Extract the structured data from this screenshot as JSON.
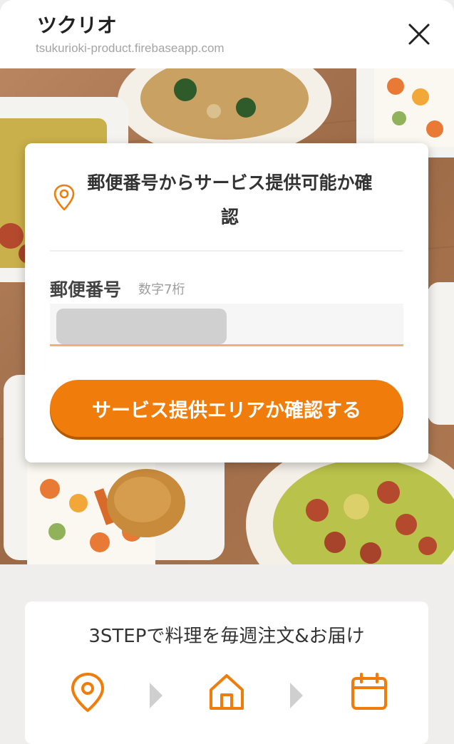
{
  "header": {
    "title": "ツクリオ",
    "url": "tsukurioki-product.firebaseapp.com"
  },
  "availability_card": {
    "title": "郵便番号からサービス提供可能か確認",
    "field_label": "郵便番号",
    "field_hint": "数字7桁",
    "input_value": "",
    "button_label": "サービス提供エリアか確認する"
  },
  "steps": {
    "title": "3STEPで料理を毎週注文&お届け",
    "icons": [
      "location-pin-icon",
      "home-icon",
      "calendar-icon"
    ]
  },
  "colors": {
    "accent": "#f07d0b",
    "input_underline": "#f2b072",
    "page_bg": "#efeeec"
  }
}
